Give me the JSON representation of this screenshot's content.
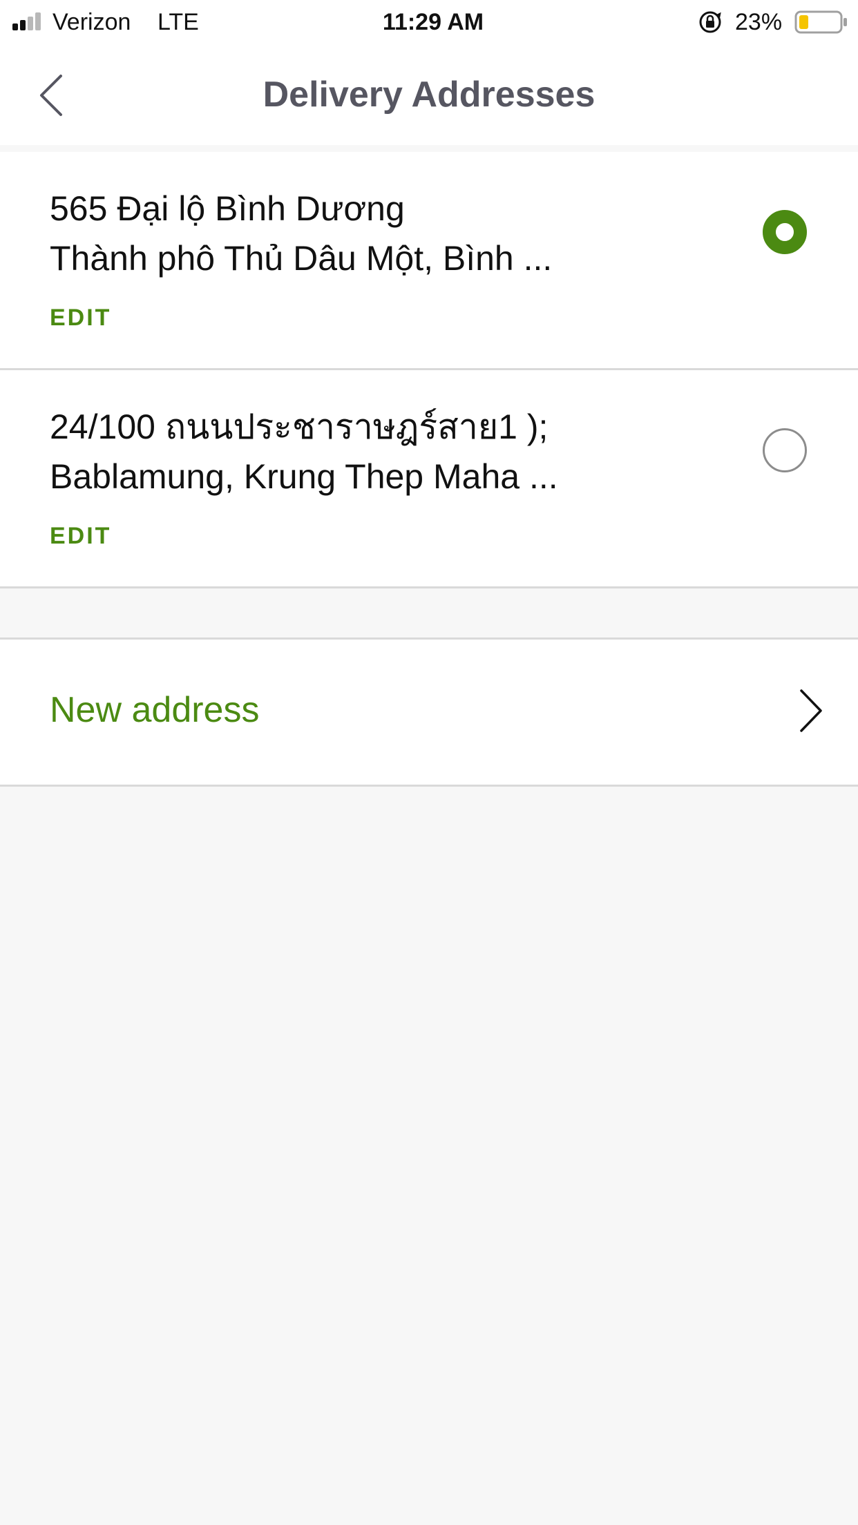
{
  "status_bar": {
    "carrier": "Verizon",
    "network": "LTE",
    "time": "11:29 AM",
    "battery_percent": "23%",
    "battery_level": 0.23,
    "battery_color": "#f5c400"
  },
  "header": {
    "title": "Delivery Addresses",
    "back_icon": "chevron-left-icon"
  },
  "addresses": [
    {
      "line1": "565 Đại lộ Bình Dương",
      "line2": "Thành phô Thủ Dâu Một, Bình ...",
      "edit_label": "EDIT",
      "selected": true
    },
    {
      "line1": "24/100 ถนนประชาราษฎร์สาย1 );",
      "line2": "Bablamung, Krung Thep Maha ...",
      "edit_label": "EDIT",
      "selected": false
    }
  ],
  "new_address": {
    "label": "New address",
    "icon": "chevron-right-icon"
  },
  "colors": {
    "accent": "#4b8a12",
    "title": "#565661",
    "background": "#f7f7f7",
    "divider": "#d9d9d9"
  }
}
